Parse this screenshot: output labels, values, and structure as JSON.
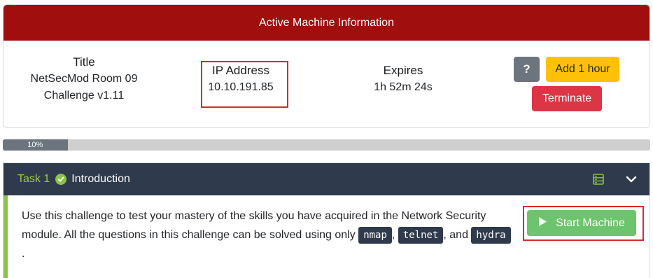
{
  "machine": {
    "header": "Active Machine Information",
    "title_label": "Title",
    "title_line1": "NetSecMod Room 09",
    "title_line2": "Challenge v1.11",
    "ip_label": "IP Address",
    "ip_value": "10.10.191.85",
    "expires_label": "Expires",
    "expires_value": "1h 52m 24s",
    "help_label": "?",
    "add_hour_label": "Add 1 hour",
    "terminate_label": "Terminate"
  },
  "progress": {
    "label": "10%",
    "value": 0.1
  },
  "task": {
    "number": "Task 1",
    "title": "Introduction",
    "text_part1": "Use this challenge to test your mastery of the skills you have acquired in the Network Security module. All the questions in this challenge can be solved using only ",
    "code1": "nmap",
    "sep1": ", ",
    "code2": "telnet",
    "sep2": ", and ",
    "code3": "hydra",
    "text_end": ".",
    "start_label": "Start Machine"
  },
  "icons": {
    "check": "check-circle-icon",
    "server": "server-icon",
    "chevron": "chevron-down-icon",
    "play": "play-icon"
  },
  "colors": {
    "header_red": "#a10e0e",
    "task_header": "#2f3b4c",
    "accent_green": "#8bc34a",
    "start_green": "#6cc46c",
    "add_yellow": "#ffc107",
    "terminate_red": "#dc3545",
    "highlight_red": "#d62c2c"
  }
}
